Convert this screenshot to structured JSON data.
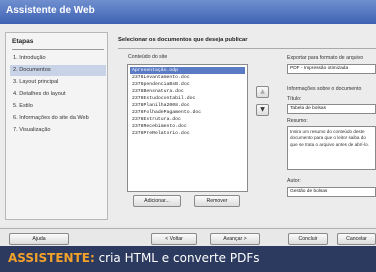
{
  "window": {
    "title": "Assistente de Web"
  },
  "steps": {
    "title": "Etapas",
    "items": [
      {
        "label": "1. Introdução",
        "active": false
      },
      {
        "label": "2. Documentos",
        "active": true
      },
      {
        "label": "3. Layout principal",
        "active": false
      },
      {
        "label": "4. Detalhes do layout",
        "active": false
      },
      {
        "label": "5. Estilo",
        "active": false
      },
      {
        "label": "6. Informações do site da Web",
        "active": false
      },
      {
        "label": "7. Visualização",
        "active": false
      }
    ]
  },
  "main": {
    "heading": "Selecionar os documentos que deseja publicar",
    "docs_label": "Conteúdo do site",
    "documents": [
      "Apresentação.odp",
      "2378Levantamento.doc",
      "2378pendenciaBsB.doc",
      "2378Bensnatura.doc",
      "2378Estudocontabil.doc",
      "2378Planilha2008.doc",
      "2378FolhadePagamento.doc",
      "2378Estrutura.doc",
      "2378Recebimento.doc",
      "2378PreRelatorio.doc"
    ],
    "add_label": "Adicionar...",
    "remove_label": "Remover",
    "arrow_up": "▲",
    "arrow_down": "▼"
  },
  "details": {
    "export_label": "Exportar para formato de arquivo",
    "export_value": "PDF - Impressão otimizada",
    "info_label": "Informações sobre o documento",
    "title_label": "Título:",
    "title_value": "Tabela de bolsas",
    "summary_label": "Resumo:",
    "summary_value": "Insira um resumo do conteúdo deste documento para que o leitor saiba do que se trata o arquivo antes de abrí-lo.",
    "author_label": "Autor:",
    "author_value": "Gestão de bolsas"
  },
  "footer": {
    "help": "Ajuda",
    "back": "< Voltar",
    "next": "Avançar >",
    "finish": "Concluir",
    "cancel": "Cancelar"
  },
  "caption": {
    "keyword": "ASSISTENTE:",
    "text": " cria HTML e converte PDFs"
  }
}
